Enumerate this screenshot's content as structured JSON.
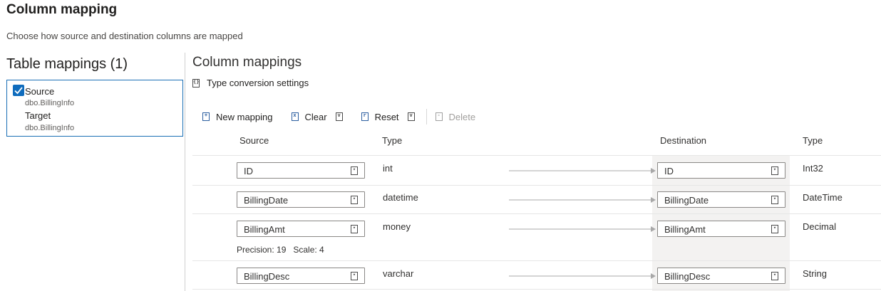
{
  "page": {
    "title": "Column mapping",
    "subtitle": "Choose how source and destination columns are mapped"
  },
  "table_mappings": {
    "heading": "Table mappings (1)",
    "items": [
      {
        "checked": true,
        "source_label": "Source",
        "source_table": "dbo.BillingInfo",
        "target_label": "Target",
        "target_table": "dbo.BillingInfo"
      }
    ]
  },
  "column_mappings": {
    "heading": "Column mappings",
    "type_conversion_label": "Type conversion settings",
    "toolbar": {
      "new_mapping": "New mapping",
      "clear": "Clear",
      "reset": "Reset",
      "delete": "Delete"
    },
    "headers": {
      "source": "Source",
      "type": "Type",
      "destination": "Destination",
      "dest_type": "Type"
    },
    "rows": [
      {
        "source": "ID",
        "source_type": "int",
        "destination": "ID",
        "dest_type": "Int32"
      },
      {
        "source": "BillingDate",
        "source_type": "datetime",
        "destination": "BillingDate",
        "dest_type": "DateTime"
      },
      {
        "source": "BillingAmt",
        "source_type": "money",
        "destination": "BillingAmt",
        "dest_type": "Decimal",
        "precision_text": "Precision: 19   Scale: 4"
      },
      {
        "source": "BillingDesc",
        "source_type": "varchar",
        "destination": "BillingDesc",
        "dest_type": "String"
      }
    ]
  },
  "colors": {
    "accent": "#0f6cbd",
    "border_selected": "#1a6fb5",
    "disabled": "#a19f9d"
  }
}
